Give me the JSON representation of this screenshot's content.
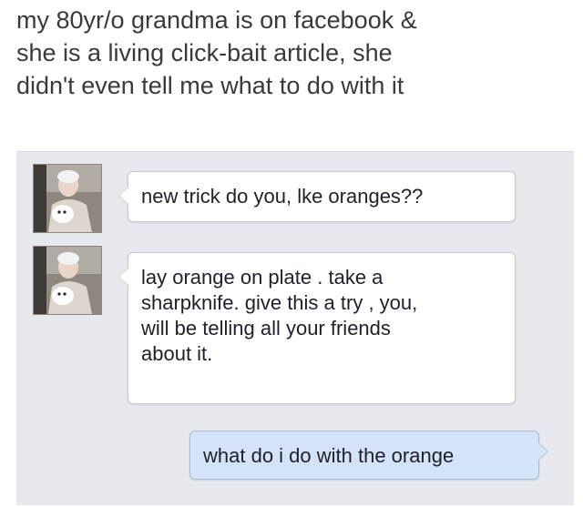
{
  "caption": {
    "line1": "my 80yr/o grandma is on facebook &",
    "line2": "she is a living click-bait article, she",
    "line3": "didn't even tell me what to do with it"
  },
  "messages": [
    {
      "sender": "grandma",
      "text": "new trick do you, lke oranges??"
    },
    {
      "sender": "grandma",
      "lines": [
        "lay orange on plate . take a",
        "sharpknife. give this a try , you,",
        "will be telling all your friends",
        "about it."
      ]
    },
    {
      "sender": "me",
      "text": "what do i do with the orange"
    }
  ],
  "colors": {
    "chat_background": "#e7e9ee",
    "incoming_bubble": "#ffffff",
    "outgoing_bubble": "#d5e3fa"
  }
}
